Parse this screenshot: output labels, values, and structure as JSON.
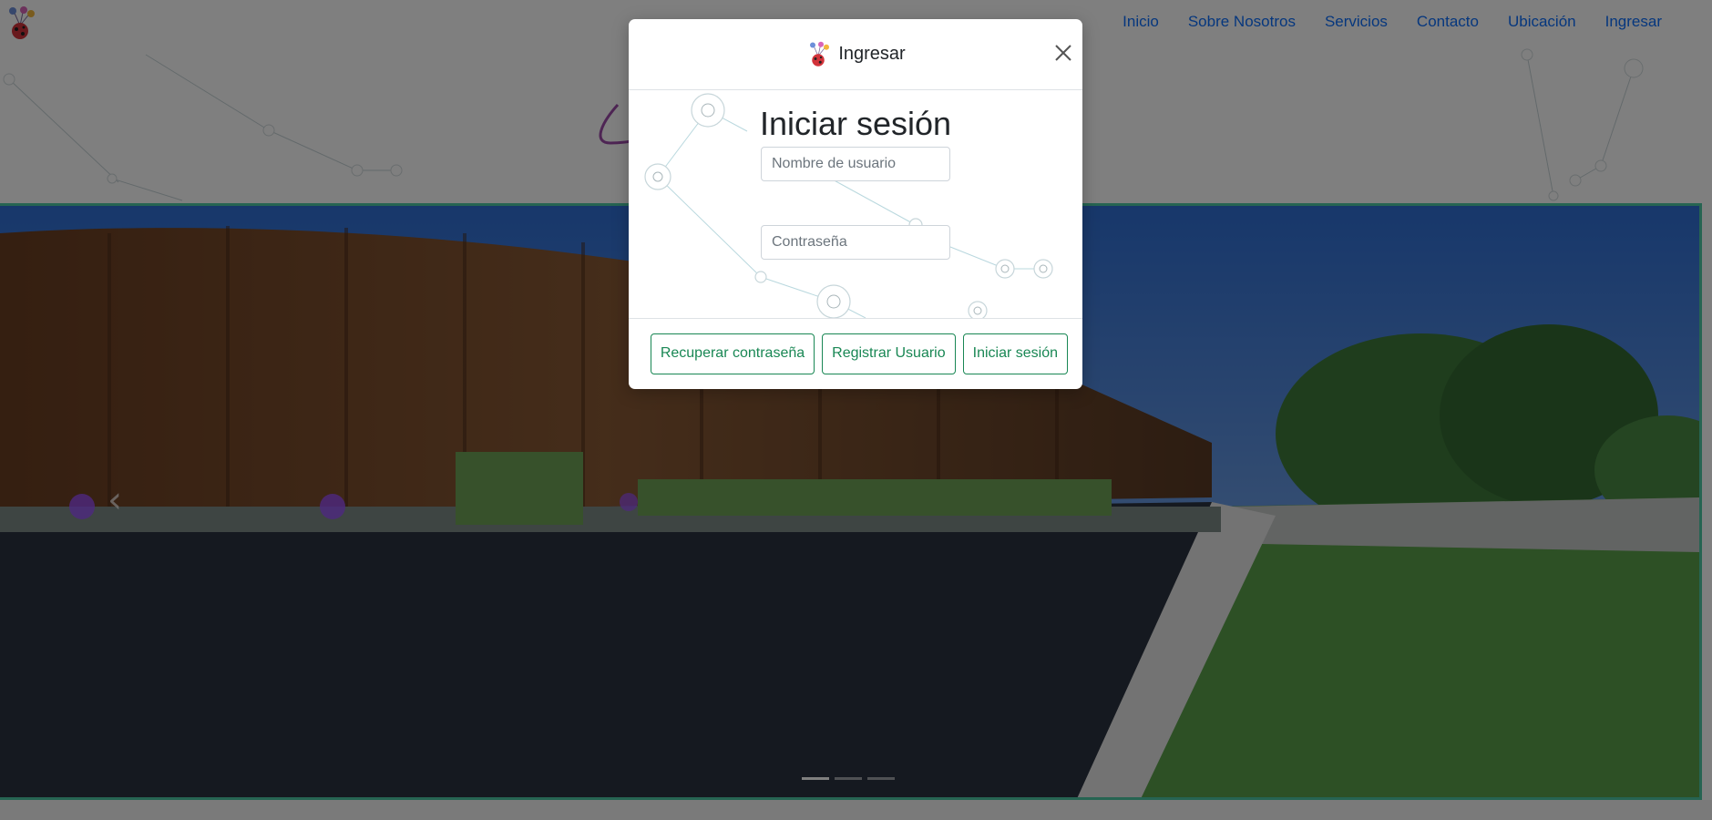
{
  "navbar": {
    "logo_icon": "balloons-ladybug-logo-icon",
    "links": [
      "Inicio",
      "Sobre Nosotros",
      "Servicios",
      "Contacto",
      "Ubicación",
      "Ingresar"
    ],
    "link_color": "#0d6efd"
  },
  "hero": {
    "border_color": "#4cc9a4",
    "slides_count": 3,
    "active_slide": 1
  },
  "modal": {
    "title": "Ingresar",
    "title_icon": "balloons-ladybug-logo-icon",
    "close_icon": "close-icon",
    "heading": "Iniciar sesión",
    "username": {
      "placeholder": "Nombre de usuario",
      "value": ""
    },
    "password": {
      "placeholder": "Contraseña",
      "value": ""
    },
    "buttons": {
      "recover": "Recuperar contraseña",
      "register": "Registrar Usuario",
      "login": "Iniciar sesión"
    },
    "button_color": "#198754"
  }
}
